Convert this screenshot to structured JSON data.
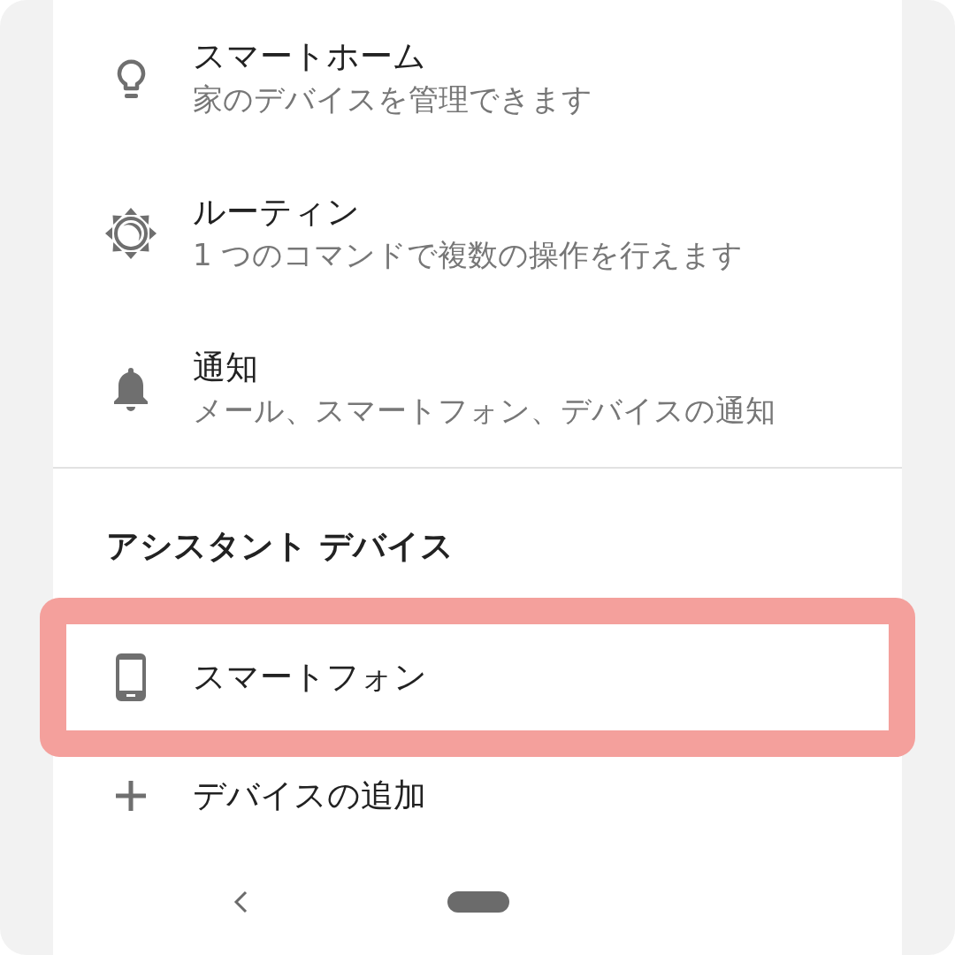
{
  "menu": [
    {
      "kind": "home",
      "title": "スマートホーム",
      "subtitle": "家のデバイスを管理できます"
    },
    {
      "kind": "routine",
      "title": "ルーティン",
      "subtitle": "1 つのコマンドで複数の操作を行えます"
    },
    {
      "kind": "notifications",
      "title": "通知",
      "subtitle": "メール、スマートフォン、デバイスの通知"
    }
  ],
  "section": {
    "title": "アシスタント デバイス"
  },
  "devices": [
    {
      "kind": "phone",
      "label": "スマートフォン",
      "highlighted": true
    },
    {
      "kind": "add",
      "label": "デバイスの追加",
      "highlighted": false
    }
  ]
}
